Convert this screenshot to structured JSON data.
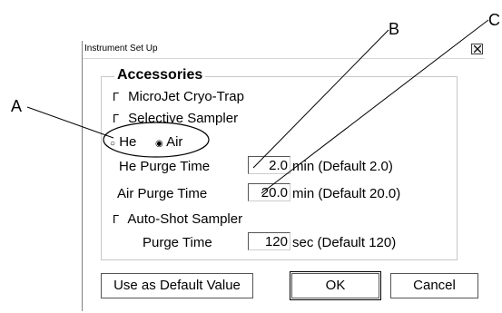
{
  "window": {
    "title": "Instrument Set Up",
    "close_glyph": "×"
  },
  "callouts": {
    "a": "A",
    "b": "B",
    "c": "C"
  },
  "accessories": {
    "title": "Accessories",
    "microjet_label": "MicroJet Cryo-Trap",
    "selective_label": "Selective Sampler",
    "he_label": "He",
    "air_label": "Air",
    "carrier_selected": "Air",
    "he_purge": {
      "label": "He Purge Time",
      "value": "2.0",
      "unit": "min (Default 2.0)"
    },
    "air_purge": {
      "label": "Air Purge Time",
      "value": "20.0",
      "unit": "min (Default 20.0)"
    },
    "autoshot_label": "Auto-Shot Sampler",
    "purge_time": {
      "label": "Purge Time",
      "value": "120",
      "unit": "sec (Default 120)"
    }
  },
  "buttons": {
    "default": "Use as Default Value",
    "ok": "OK",
    "cancel": "Cancel"
  },
  "glyphs": {
    "checkbox": "Γ",
    "radio_off": "○",
    "radio_on": "◉"
  }
}
